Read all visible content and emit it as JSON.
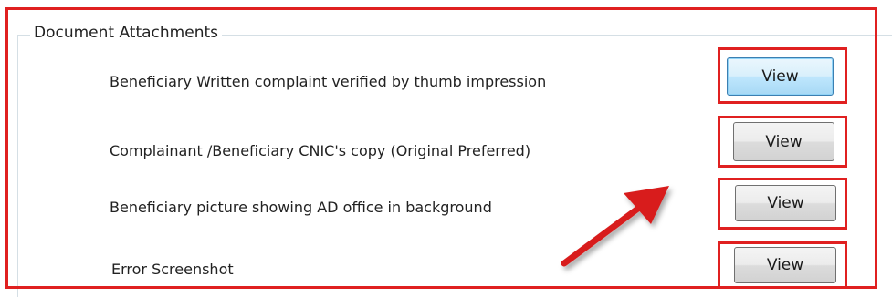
{
  "group": {
    "title": "Document Attachments"
  },
  "rows": [
    {
      "label": "Beneficiary Written complaint verified by thumb impression",
      "button": "View"
    },
    {
      "label": "Complainant /Beneficiary CNIC's copy (Original Preferred)",
      "button": "View"
    },
    {
      "label": "Beneficiary picture showing AD office in background",
      "button": "View"
    },
    {
      "label": "Error Screenshot",
      "button": "View"
    }
  ],
  "colors": {
    "highlight": "#e02020",
    "focused_button": "#bee6fd",
    "arrow": "#d81e1e"
  },
  "icons": {
    "annotation": "red-arrow-icon"
  }
}
